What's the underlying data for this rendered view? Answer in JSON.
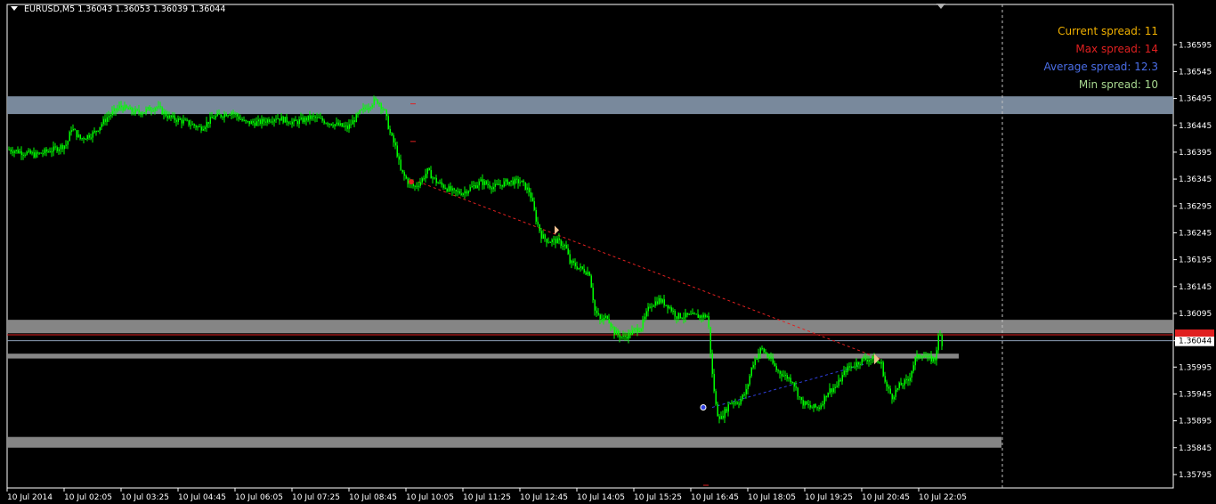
{
  "header": {
    "symbol": "EURUSD,M5",
    "ohlc": "1.36043 1.36053 1.36039 1.36044"
  },
  "spread_panel": {
    "current": {
      "label": "Current spread: 11",
      "color": "#f0b000"
    },
    "max": {
      "label": "Max spread: 14",
      "color": "#e02020"
    },
    "average": {
      "label": "Average spread: 12.3",
      "color": "#4a6ee8"
    },
    "min": {
      "label": "Min spread: 10",
      "color": "#a8d890"
    }
  },
  "colors": {
    "background": "#000000",
    "candle": "#00ff00",
    "axis": "#ffffff",
    "zone_blue": "#8090a4",
    "zone_gray": "#8c8c8c",
    "bid_line": "#e02020",
    "ask_line": "#8ea0b8",
    "price_label_bg": "#ffffff",
    "price_label_red": "#e02020",
    "sell_trend": "#e02020",
    "buy_trend": "#3040e0",
    "period_separator": "#c0c0c0"
  },
  "chart_data": {
    "type": "candlestick",
    "instrument": "EURUSD",
    "timeframe": "M5",
    "ylim": [
      1.3577,
      1.3667
    ],
    "y_ticks": [
      "1.36595",
      "1.36545",
      "1.36495",
      "1.36445",
      "1.36395",
      "1.36345",
      "1.36295",
      "1.36245",
      "1.36195",
      "1.36145",
      "1.36095",
      "1.36044",
      "1.35995",
      "1.35945",
      "1.35895",
      "1.35845",
      "1.35795"
    ],
    "x_ticks": [
      "10 Jul 2014",
      "10 Jul 02:05",
      "10 Jul 03:25",
      "10 Jul 04:45",
      "10 Jul 06:05",
      "10 Jul 07:25",
      "10 Jul 08:45",
      "10 Jul 10:05",
      "10 Jul 11:25",
      "10 Jul 12:45",
      "10 Jul 14:05",
      "10 Jul 15:25",
      "10 Jul 16:45",
      "10 Jul 18:05",
      "10 Jul 19:25",
      "10 Jul 20:45",
      "10 Jul 22:05"
    ],
    "current_price": "1.36044",
    "ask_price": "1.36055",
    "price_path": [
      [
        0,
        1.364
      ],
      [
        30,
        1.3639
      ],
      [
        50,
        1.364
      ],
      [
        65,
        1.3641
      ],
      [
        70,
        1.3644
      ],
      [
        80,
        1.3642
      ],
      [
        95,
        1.3643
      ],
      [
        110,
        1.3646
      ],
      [
        125,
        1.3648
      ],
      [
        140,
        1.3647
      ],
      [
        150,
        1.3647
      ],
      [
        165,
        1.3648
      ],
      [
        180,
        1.3646
      ],
      [
        200,
        1.3645
      ],
      [
        215,
        1.3644
      ],
      [
        230,
        1.3646
      ],
      [
        250,
        1.3647
      ],
      [
        265,
        1.3645
      ],
      [
        280,
        1.3645
      ],
      [
        300,
        1.3646
      ],
      [
        320,
        1.3645
      ],
      [
        340,
        1.3646
      ],
      [
        360,
        1.3645
      ],
      [
        380,
        1.3644
      ],
      [
        395,
        1.3647
      ],
      [
        410,
        1.3649
      ],
      [
        415,
        1.3649
      ],
      [
        422,
        1.3647
      ],
      [
        428,
        1.3643
      ],
      [
        435,
        1.364
      ],
      [
        440,
        1.3636
      ],
      [
        448,
        1.3634
      ],
      [
        455,
        1.3633
      ],
      [
        462,
        1.3634
      ],
      [
        470,
        1.3636
      ],
      [
        480,
        1.3634
      ],
      [
        490,
        1.3633
      ],
      [
        500,
        1.3632
      ],
      [
        510,
        1.3632
      ],
      [
        520,
        1.3633
      ],
      [
        530,
        1.3634
      ],
      [
        545,
        1.3633
      ],
      [
        560,
        1.3634
      ],
      [
        575,
        1.3634
      ],
      [
        585,
        1.3632
      ],
      [
        592,
        1.3627
      ],
      [
        598,
        1.3624
      ],
      [
        605,
        1.3623
      ],
      [
        615,
        1.3623
      ],
      [
        625,
        1.3622
      ],
      [
        630,
        1.3619
      ],
      [
        640,
        1.3618
      ],
      [
        652,
        1.3617
      ],
      [
        658,
        1.361
      ],
      [
        665,
        1.3608
      ],
      [
        672,
        1.3609
      ],
      [
        680,
        1.3606
      ],
      [
        690,
        1.3605
      ],
      [
        700,
        1.3606
      ],
      [
        710,
        1.3607
      ],
      [
        720,
        1.3611
      ],
      [
        730,
        1.3612
      ],
      [
        740,
        1.3611
      ],
      [
        750,
        1.3609
      ],
      [
        760,
        1.3609
      ],
      [
        770,
        1.3609
      ],
      [
        785,
        1.3609
      ],
      [
        790,
        1.3598
      ],
      [
        795,
        1.3591
      ],
      [
        800,
        1.359
      ],
      [
        810,
        1.3593
      ],
      [
        820,
        1.3593
      ],
      [
        828,
        1.3595
      ],
      [
        835,
        1.36
      ],
      [
        845,
        1.3603
      ],
      [
        855,
        1.3601
      ],
      [
        862,
        1.3599
      ],
      [
        870,
        1.3598
      ],
      [
        880,
        1.3597
      ],
      [
        890,
        1.3593
      ],
      [
        900,
        1.3592
      ],
      [
        910,
        1.3592
      ],
      [
        920,
        1.3595
      ],
      [
        930,
        1.3596
      ],
      [
        940,
        1.3599
      ],
      [
        950,
        1.36
      ],
      [
        960,
        1.3601
      ],
      [
        970,
        1.3601
      ],
      [
        980,
        1.36
      ],
      [
        985,
        1.3596
      ],
      [
        992,
        1.3594
      ],
      [
        1000,
        1.3596
      ],
      [
        1010,
        1.3597
      ],
      [
        1018,
        1.3601
      ],
      [
        1025,
        1.3602
      ],
      [
        1032,
        1.3601
      ],
      [
        1040,
        1.3601
      ],
      [
        1045,
        1.3606
      ],
      [
        1048,
        1.3604
      ]
    ],
    "zones": [
      {
        "y_top": 1.36499,
        "y_bottom": 1.36466,
        "kind": "blue"
      },
      {
        "y_top": 1.36083,
        "y_bottom": 1.36058,
        "kind": "gray"
      },
      {
        "y_top": 1.3602,
        "y_bottom": 1.36011,
        "kind": "gray"
      },
      {
        "y_top": 1.35865,
        "y_bottom": 1.35845,
        "kind": "gray"
      }
    ],
    "trend_lines": [
      {
        "from": [
          460,
          1.3634
        ],
        "to": [
          980,
          1.3601
        ],
        "kind": "sell"
      },
      {
        "from": [
          790,
          1.3592
        ],
        "to": [
          960,
          1.36
        ],
        "kind": "buy"
      }
    ]
  }
}
